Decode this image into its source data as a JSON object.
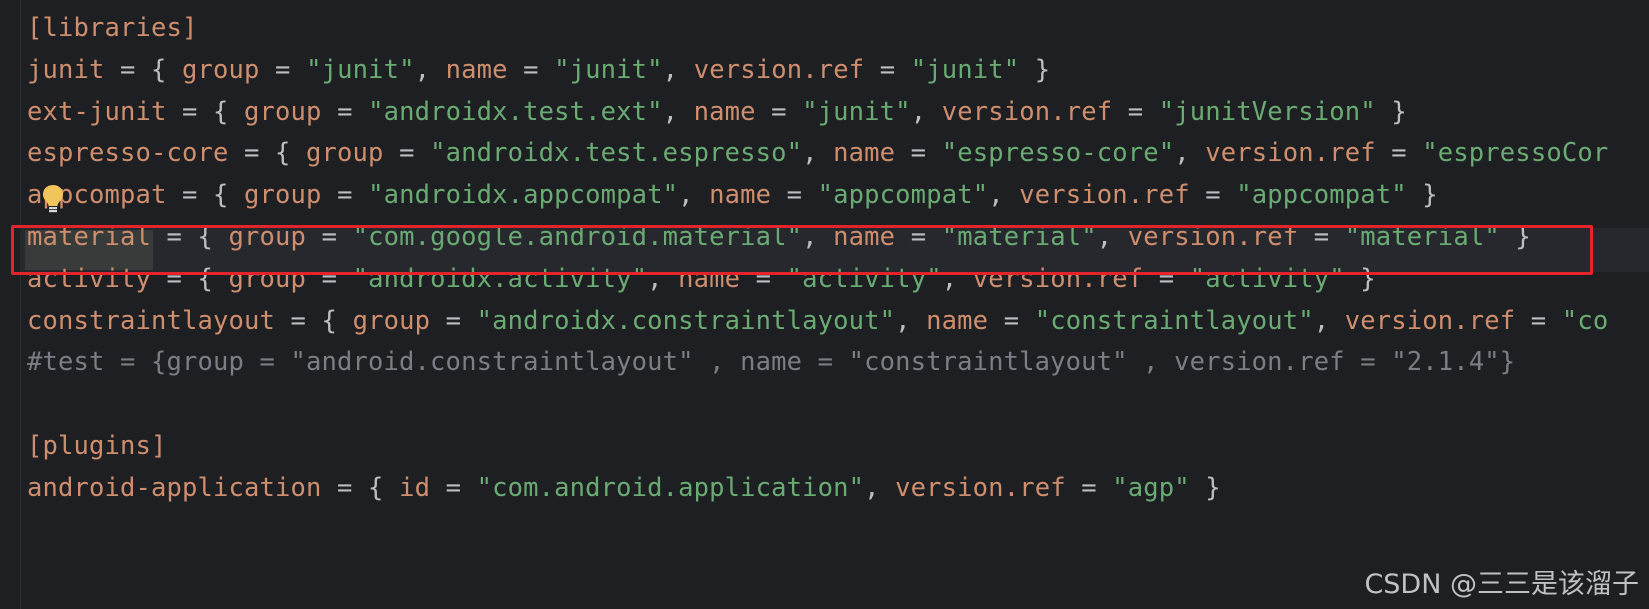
{
  "editor": {
    "lines": [
      [
        {
          "t": "[libraries]",
          "c": "k"
        }
      ],
      [
        {
          "t": "junit",
          "c": "k"
        },
        {
          "t": " = { ",
          "c": "p"
        },
        {
          "t": "group",
          "c": "k"
        },
        {
          "t": " = ",
          "c": "p"
        },
        {
          "t": "\"junit\"",
          "c": "s"
        },
        {
          "t": ", ",
          "c": "p"
        },
        {
          "t": "name",
          "c": "k"
        },
        {
          "t": " = ",
          "c": "p"
        },
        {
          "t": "\"junit\"",
          "c": "s"
        },
        {
          "t": ", ",
          "c": "p"
        },
        {
          "t": "version.ref",
          "c": "k"
        },
        {
          "t": " = ",
          "c": "p"
        },
        {
          "t": "\"junit\"",
          "c": "s"
        },
        {
          "t": " }",
          "c": "p"
        }
      ],
      [
        {
          "t": "ext-junit",
          "c": "k"
        },
        {
          "t": " = { ",
          "c": "p"
        },
        {
          "t": "group",
          "c": "k"
        },
        {
          "t": " = ",
          "c": "p"
        },
        {
          "t": "\"androidx.test.ext\"",
          "c": "s"
        },
        {
          "t": ", ",
          "c": "p"
        },
        {
          "t": "name",
          "c": "k"
        },
        {
          "t": " = ",
          "c": "p"
        },
        {
          "t": "\"junit\"",
          "c": "s"
        },
        {
          "t": ", ",
          "c": "p"
        },
        {
          "t": "version.ref",
          "c": "k"
        },
        {
          "t": " = ",
          "c": "p"
        },
        {
          "t": "\"junitVersion\"",
          "c": "s"
        },
        {
          "t": " }",
          "c": "p"
        }
      ],
      [
        {
          "t": "espresso-core",
          "c": "k"
        },
        {
          "t": " = { ",
          "c": "p"
        },
        {
          "t": "group",
          "c": "k"
        },
        {
          "t": " = ",
          "c": "p"
        },
        {
          "t": "\"androidx.test.espresso\"",
          "c": "s"
        },
        {
          "t": ", ",
          "c": "p"
        },
        {
          "t": "name",
          "c": "k"
        },
        {
          "t": " = ",
          "c": "p"
        },
        {
          "t": "\"espresso-core\"",
          "c": "s"
        },
        {
          "t": ", ",
          "c": "p"
        },
        {
          "t": "version.ref",
          "c": "k"
        },
        {
          "t": " = ",
          "c": "p"
        },
        {
          "t": "\"espressoCor",
          "c": "s"
        }
      ],
      [
        {
          "t": "appcompat",
          "c": "k"
        },
        {
          "t": " = { ",
          "c": "p"
        },
        {
          "t": "group",
          "c": "k"
        },
        {
          "t": " = ",
          "c": "p"
        },
        {
          "t": "\"androidx.appcompat\"",
          "c": "s"
        },
        {
          "t": ", ",
          "c": "p"
        },
        {
          "t": "name",
          "c": "k"
        },
        {
          "t": " = ",
          "c": "p"
        },
        {
          "t": "\"appcompat\"",
          "c": "s"
        },
        {
          "t": ", ",
          "c": "p"
        },
        {
          "t": "version.ref",
          "c": "k"
        },
        {
          "t": " = ",
          "c": "p"
        },
        {
          "t": "\"appcompat\"",
          "c": "s"
        },
        {
          "t": " }",
          "c": "p"
        }
      ],
      [
        {
          "t": "material",
          "c": "k"
        },
        {
          "t": " = { ",
          "c": "p"
        },
        {
          "t": "group",
          "c": "k"
        },
        {
          "t": " = ",
          "c": "p"
        },
        {
          "t": "\"com.google.android.material\"",
          "c": "s"
        },
        {
          "t": ", ",
          "c": "p"
        },
        {
          "t": "name",
          "c": "k"
        },
        {
          "t": " = ",
          "c": "p"
        },
        {
          "t": "\"material\"",
          "c": "s"
        },
        {
          "t": ", ",
          "c": "p"
        },
        {
          "t": "version.ref",
          "c": "k"
        },
        {
          "t": " = ",
          "c": "p"
        },
        {
          "t": "\"material\"",
          "c": "s"
        },
        {
          "t": " }",
          "c": "p"
        }
      ],
      [
        {
          "t": "activity",
          "c": "k"
        },
        {
          "t": " = { ",
          "c": "p"
        },
        {
          "t": "group",
          "c": "k"
        },
        {
          "t": " = ",
          "c": "p"
        },
        {
          "t": "\"androidx.activity\"",
          "c": "s"
        },
        {
          "t": ", ",
          "c": "p"
        },
        {
          "t": "name",
          "c": "k"
        },
        {
          "t": " = ",
          "c": "p"
        },
        {
          "t": "\"activity\"",
          "c": "s"
        },
        {
          "t": ", ",
          "c": "p"
        },
        {
          "t": "version.ref",
          "c": "k"
        },
        {
          "t": " = ",
          "c": "p"
        },
        {
          "t": "\"activity\"",
          "c": "s"
        },
        {
          "t": " }",
          "c": "p"
        }
      ],
      [
        {
          "t": "constraintlayout",
          "c": "k"
        },
        {
          "t": " = { ",
          "c": "p"
        },
        {
          "t": "group",
          "c": "k"
        },
        {
          "t": " = ",
          "c": "p"
        },
        {
          "t": "\"androidx.constraintlayout\"",
          "c": "s"
        },
        {
          "t": ", ",
          "c": "p"
        },
        {
          "t": "name",
          "c": "k"
        },
        {
          "t": " = ",
          "c": "p"
        },
        {
          "t": "\"constraintlayout\"",
          "c": "s"
        },
        {
          "t": ", ",
          "c": "p"
        },
        {
          "t": "version.ref",
          "c": "k"
        },
        {
          "t": " = ",
          "c": "p"
        },
        {
          "t": "\"co",
          "c": "s"
        }
      ],
      [
        {
          "t": "#test = {group = \"android.constraintlayout\" , name = \"constraintlayout\" , version.ref = \"2.1.4\"}",
          "c": "c"
        }
      ],
      [],
      [
        {
          "t": "[plugins]",
          "c": "k"
        }
      ],
      [
        {
          "t": "android-application",
          "c": "k"
        },
        {
          "t": " = { ",
          "c": "p"
        },
        {
          "t": "id",
          "c": "k"
        },
        {
          "t": " = ",
          "c": "p"
        },
        {
          "t": "\"com.android.application\"",
          "c": "s"
        },
        {
          "t": ", ",
          "c": "p"
        },
        {
          "t": "version.ref",
          "c": "k"
        },
        {
          "t": " = ",
          "c": "p"
        },
        {
          "t": "\"agp\"",
          "c": "s"
        },
        {
          "t": " }",
          "c": "p"
        }
      ]
    ],
    "highlighted_line_index": 5,
    "icons": {
      "gutter": "lightbulb-icon"
    }
  },
  "colors": {
    "background": "#1e1f22",
    "keyword": "#cf8e6d",
    "string": "#6aab73",
    "plain": "#bcbec4",
    "comment": "#7a7e85",
    "highlight_border": "#e3242b",
    "bulb": "#f2c55c"
  },
  "watermark": {
    "text": "CSDN @三三是该溜子"
  }
}
